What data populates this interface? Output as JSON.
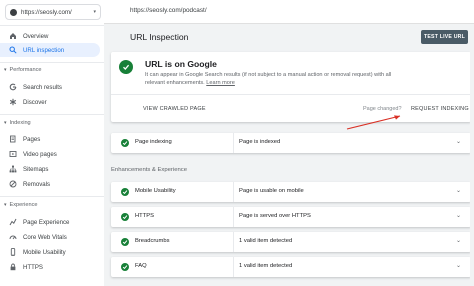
{
  "property": {
    "url": "https://seosly.com/",
    "caret": "▾"
  },
  "topbar": {
    "inspected_url": "https://seosly.com/podcast/"
  },
  "sidebar": {
    "top_items": [
      {
        "label": "Overview",
        "icon": "home-icon"
      },
      {
        "label": "URL inspection",
        "icon": "search-icon",
        "active": true
      }
    ],
    "sections": [
      {
        "label": "Performance",
        "items": [
          {
            "label": "Search results",
            "icon": "google-g-icon"
          },
          {
            "label": "Discover",
            "icon": "asterisk-icon"
          }
        ]
      },
      {
        "label": "Indexing",
        "items": [
          {
            "label": "Pages",
            "icon": "pages-icon"
          },
          {
            "label": "Video pages",
            "icon": "video-pages-icon"
          },
          {
            "label": "Sitemaps",
            "icon": "sitemaps-icon"
          },
          {
            "label": "Removals",
            "icon": "removals-icon"
          }
        ]
      },
      {
        "label": "Experience",
        "items": [
          {
            "label": "Page Experience",
            "icon": "page-experience-icon"
          },
          {
            "label": "Core Web Vitals",
            "icon": "gauge-icon"
          },
          {
            "label": "Mobile Usability",
            "icon": "mobile-icon"
          },
          {
            "label": "HTTPS",
            "icon": "lock-icon"
          }
        ]
      }
    ]
  },
  "main": {
    "title": "URL Inspection",
    "test_live_label": "TEST LIVE URL",
    "status_title": "URL is on Google",
    "status_desc": "It can appear in Google Search results (if not subject to a manual action or removal request) with all relevant enhancements.",
    "learn_more": "Learn more",
    "view_crawled": "VIEW CRAWLED PAGE",
    "page_changed": "Page changed?",
    "request_indexing": "REQUEST INDEXING",
    "indexing_row": {
      "name": "Page indexing",
      "status": "Page is indexed"
    },
    "enhancements_heading": "Enhancements & Experience",
    "enhancements": [
      {
        "name": "Mobile Usability",
        "status": "Page is usable on mobile"
      },
      {
        "name": "HTTPS",
        "status": "Page is served over HTTPS"
      },
      {
        "name": "Breadcrumbs",
        "status": "1 valid item detected"
      },
      {
        "name": "FAQ",
        "status": "1 valid item detected"
      }
    ]
  },
  "colors": {
    "success": "#188038",
    "accent": "#1a73e8",
    "annotation_arrow": "#d93025",
    "button_dark": "#4a5b66"
  }
}
